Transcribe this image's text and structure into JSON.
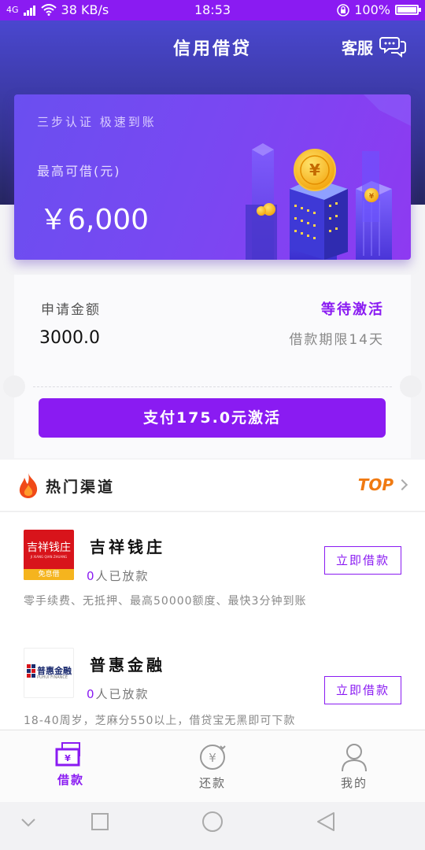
{
  "status_bar": {
    "signal": "4G",
    "speed": "38 KB/s",
    "time": "18:53",
    "battery": "100%",
    "battery_level": 1.0
  },
  "header": {
    "title": "信用借贷",
    "service_label": "客服"
  },
  "hero": {
    "tagline": "三步认证  极速到账",
    "max_label": "最高可借(元)",
    "max_amount": "￥6,000"
  },
  "application": {
    "amount_label": "申请金额",
    "status": "等待激活",
    "amount": "3000.0",
    "term": "借款期限14天",
    "pay_button": "支付175.0元激活"
  },
  "hot_channels": {
    "title": "热门渠道",
    "top_label": "TOP",
    "items": [
      {
        "name": "吉祥钱庄",
        "logo_text": "吉祥钱庄",
        "logo_sub": "JI XIANG QIAN ZHUANG",
        "logo_badge": "免息借",
        "lent_count": "0",
        "lent_suffix": "人已放款",
        "description": "零手续费、无抵押、最高50000额度、最快3分钟到账",
        "button": "立即借款"
      },
      {
        "name": "普惠金融",
        "logo_text": "普惠金融",
        "logo_sub": "PUHUI FINANCE",
        "lent_count": "0",
        "lent_suffix": "人已放款",
        "description": "18-40周岁，芝麻分550以上，借贷宝无黑即可下款",
        "button": "立即借款"
      }
    ]
  },
  "tabbar": {
    "items": [
      {
        "label": "借款",
        "icon": "loan-icon",
        "active": true
      },
      {
        "label": "还款",
        "icon": "repay-icon",
        "active": false
      },
      {
        "label": "我的",
        "icon": "profile-icon",
        "active": false
      }
    ]
  },
  "colors": {
    "accent": "#8a1bf2",
    "header_top": "#4a47cf",
    "header_bottom": "#262660",
    "top_orange": "#f07a12",
    "logo_red": "#d8141b"
  }
}
